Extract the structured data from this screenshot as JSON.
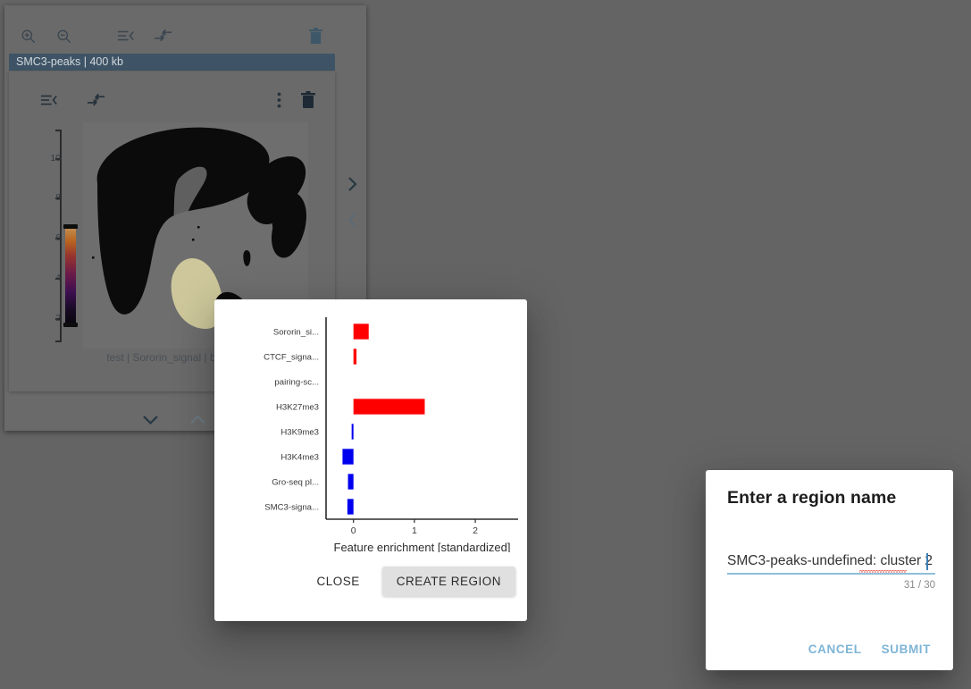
{
  "window": {
    "background_color": "#646464",
    "panel_color": "#6a6a6a"
  },
  "app_panel": {
    "toolbar": {
      "zoom_in_label": "zoom-in",
      "zoom_out_label": "zoom-out",
      "list_label": "list-collapse",
      "arrow_label": "arrow-collapse",
      "delete_label": "delete"
    },
    "title": "SMC3-peaks | 400 kb",
    "track_toolbar": {
      "list_label": "list-collapse",
      "arrow_label": "arrow-collapse",
      "more_label": "more-options",
      "delete_label": "delete"
    },
    "plot": {
      "caption": "test | Sororin_signal | binsiz",
      "y_ticks": [
        "10",
        "8",
        "6",
        "4",
        "2"
      ],
      "colorbar_gradient": "inferno"
    },
    "nav": {
      "next_label": "next",
      "prev_label": "previous",
      "down_label": "scroll-down",
      "up_label": "scroll-up"
    }
  },
  "chart_dialog": {
    "close_label": "CLOSE",
    "create_region_label": "CREATE REGION"
  },
  "chart_data": {
    "type": "bar",
    "orientation": "horizontal",
    "title": "",
    "xlabel": "Feature enrichment [standardized]",
    "ylabel": "",
    "xlim": [
      -0.45,
      2.6
    ],
    "xticks": [
      0,
      1,
      2
    ],
    "xticklabels": [
      "0",
      "1",
      "2"
    ],
    "grid": false,
    "categories": [
      "Sororin_si...",
      "CTCF_signa...",
      "pairing-sc...",
      "H3K27me3",
      "H3K9me3",
      "H3K4me3",
      "Gro-seq pl...",
      "SMC3-signa..."
    ],
    "values": [
      0.25,
      0.05,
      0.0,
      1.17,
      -0.03,
      -0.18,
      -0.09,
      -0.1
    ],
    "positive_color": "#ff0000",
    "negative_color": "#0000ee"
  },
  "name_dialog": {
    "title": "Enter a region name",
    "input_value": "SMC3-peaks-undefined: cluster 2",
    "input_placeholder": "",
    "counter": "31 / 30",
    "cancel_label": "CANCEL",
    "submit_label": "SUBMIT",
    "accent_color": "#7eb5d6"
  }
}
